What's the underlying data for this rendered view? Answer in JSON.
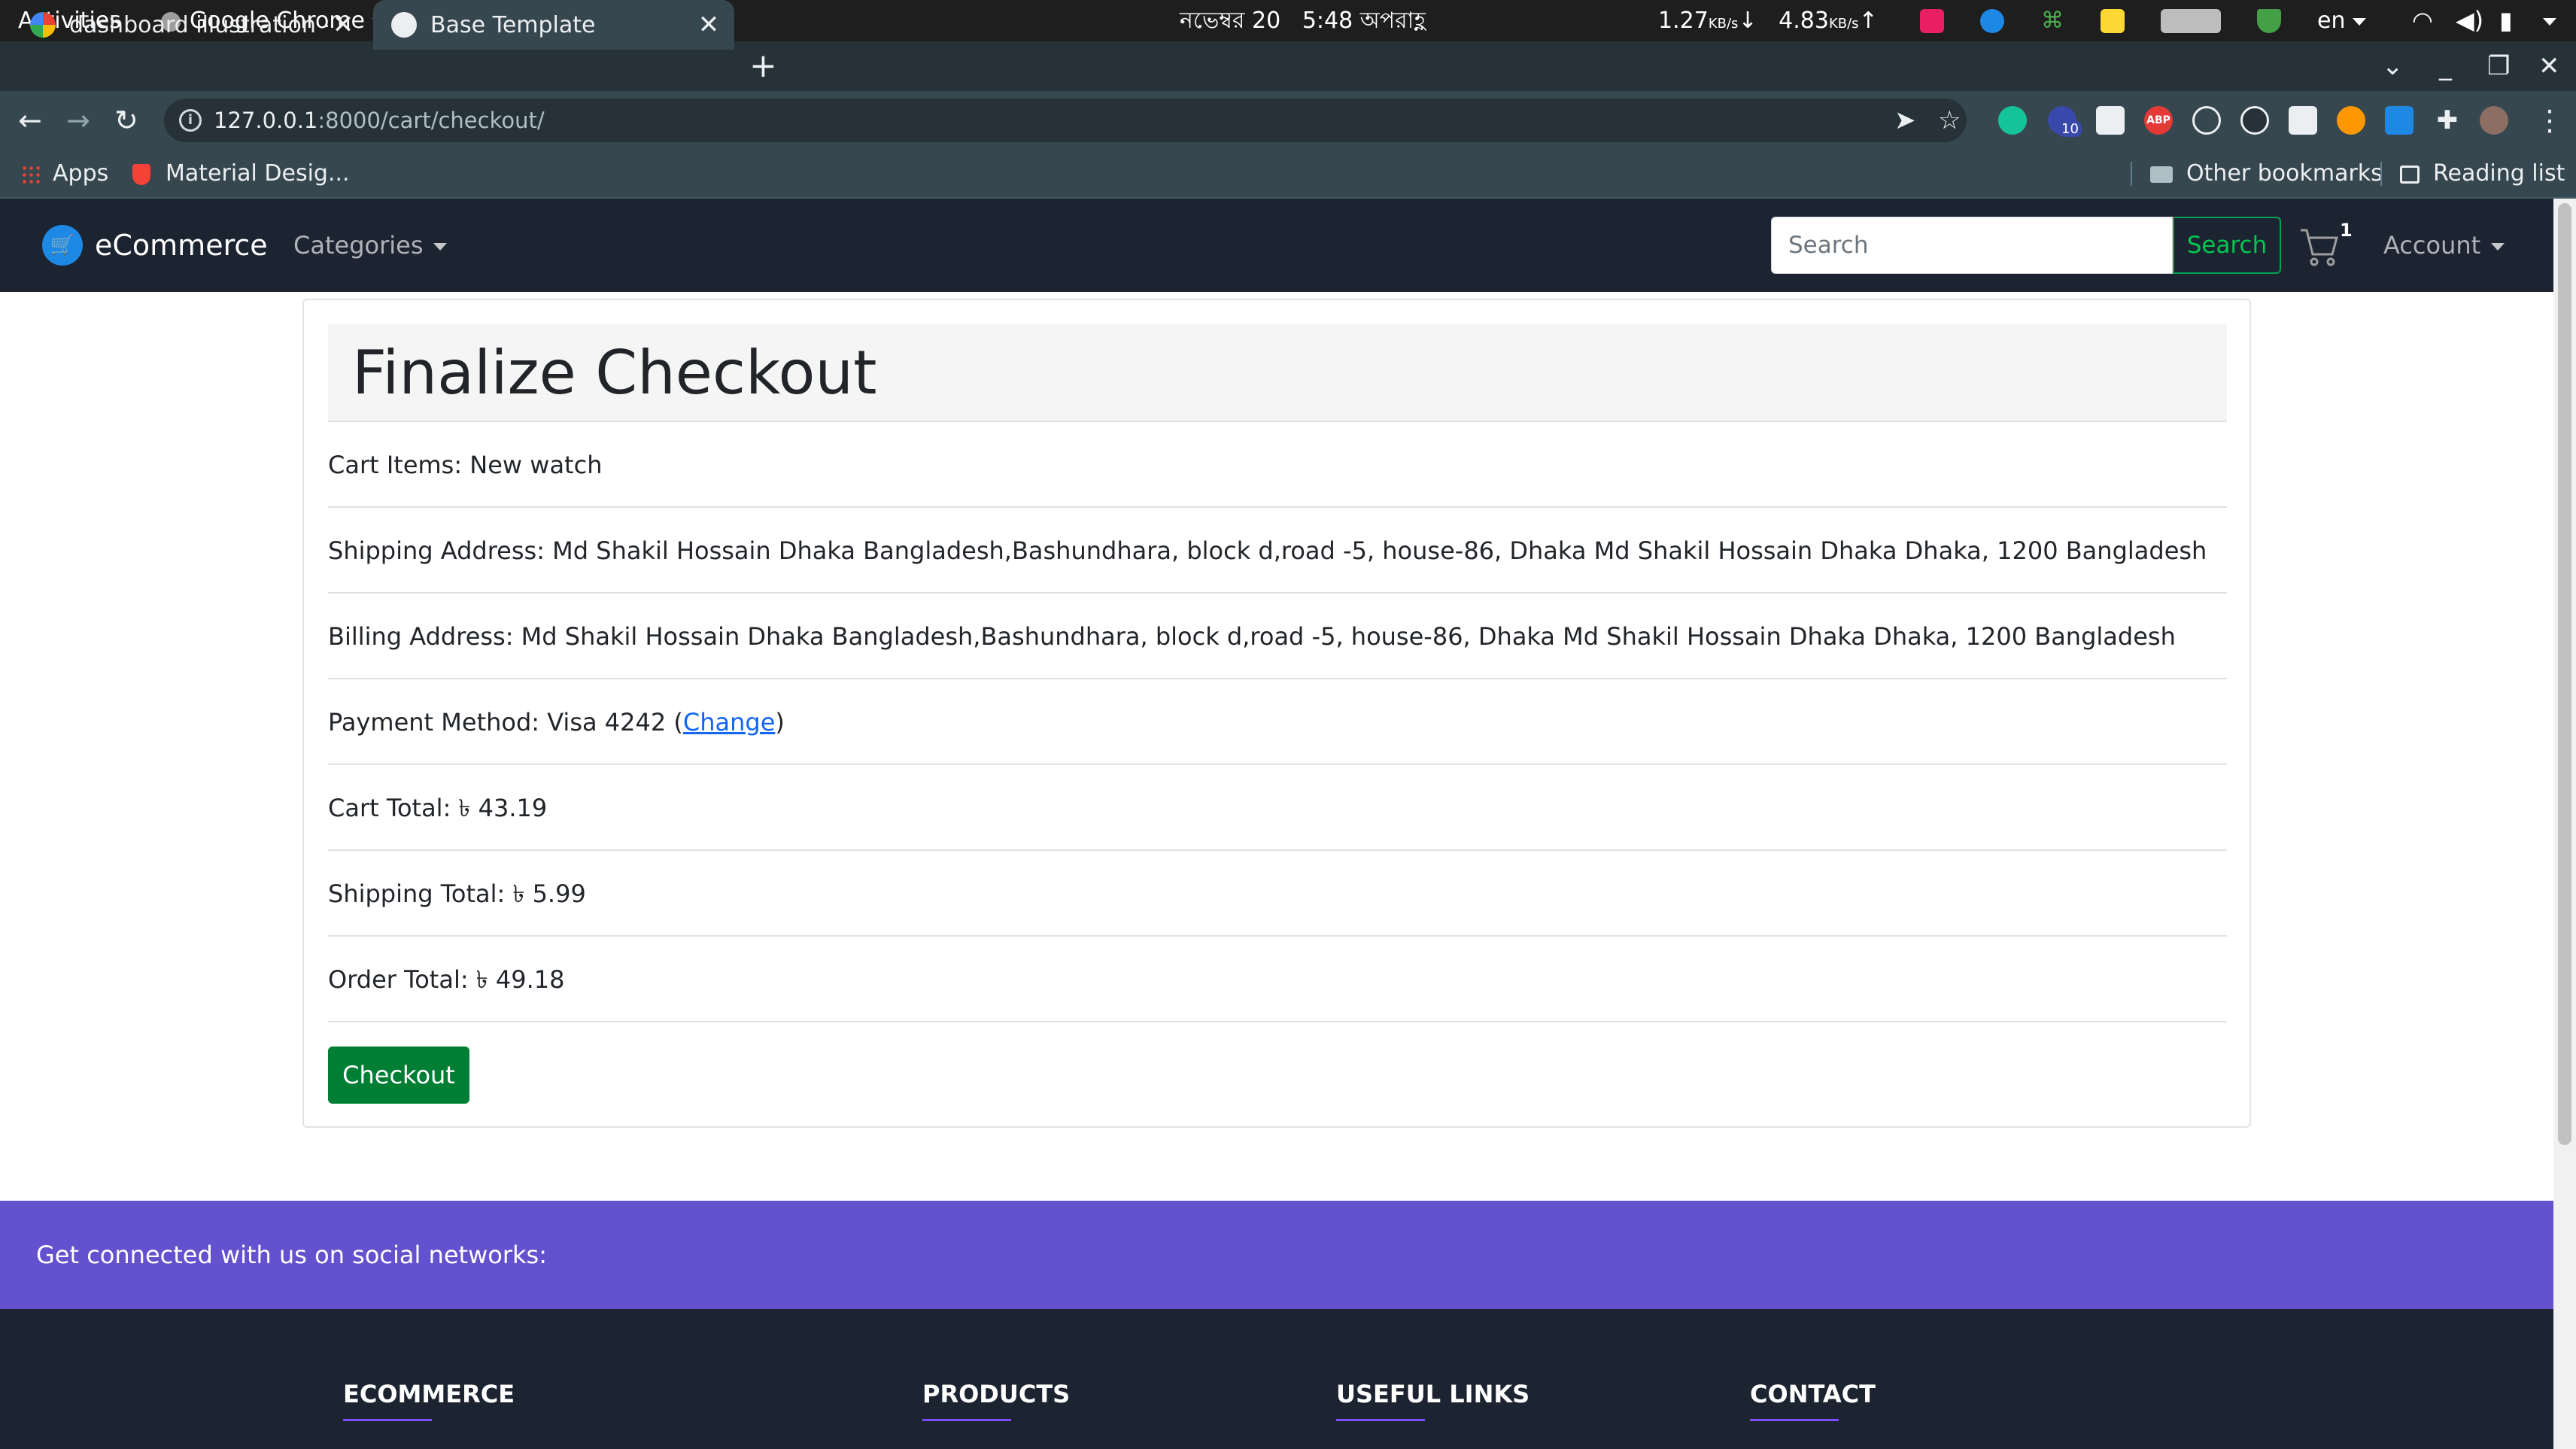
{
  "os": {
    "activities": "Activities",
    "app_name": "Google Chrome",
    "date": "নভেম্বর 20",
    "time": "5:48 অপরাহ্ণ",
    "net_down": "1.27",
    "net_down_unit": "KB/s",
    "net_up": "4.83",
    "net_up_unit": "KB/s",
    "language": "en"
  },
  "browser": {
    "tabs": [
      {
        "title": "dashboard illustration - G",
        "active": false
      },
      {
        "title": "Base Template",
        "active": true
      }
    ],
    "new_tab": "+",
    "url_host": "127.0.0.1",
    "url_path": ":8000/cart/checkout/",
    "bookmarks": [
      {
        "label": "Apps"
      },
      {
        "label": "Material Desig..."
      }
    ],
    "other_bookmarks": "Other bookmarks",
    "reading_list": "Reading list",
    "ext_badge": "10"
  },
  "navbar": {
    "brand": "eCommerce",
    "categories": "Categories",
    "search_placeholder": "Search",
    "search_button": "Search",
    "cart_count": "1",
    "account": "Account"
  },
  "checkout": {
    "title": "Finalize Checkout",
    "cart_items": "Cart Items: New watch",
    "shipping_address": "Shipping Address: Md Shakil Hossain Dhaka Bangladesh,Bashundhara, block d,road -5, house-86, Dhaka Md Shakil Hossain Dhaka Dhaka, 1200 Bangladesh",
    "billing_address": "Billing Address: Md Shakil Hossain Dhaka Bangladesh,Bashundhara, block d,road -5, house-86, Dhaka Md Shakil Hossain Dhaka Dhaka, 1200 Bangladesh",
    "payment_prefix": "Payment Method: Visa 4242 (",
    "payment_change": "Change",
    "payment_suffix": ")",
    "cart_total": "Cart Total: ৳ 43.19",
    "shipping_total": "Shipping Total: ৳ 5.99",
    "order_total": "Order Total: ৳ 49.18",
    "checkout_button": "Checkout"
  },
  "footer": {
    "social_text": "Get connected with us on social networks:",
    "columns": [
      "ECOMMERCE",
      "PRODUCTS",
      "USEFUL LINKS",
      "CONTACT"
    ]
  },
  "colors": {
    "navbar_bg": "#1c2331",
    "social_bar_bg": "#6351ce",
    "checkout_btn": "#007e33",
    "search_btn": "#00c851",
    "link": "#1266f1"
  }
}
